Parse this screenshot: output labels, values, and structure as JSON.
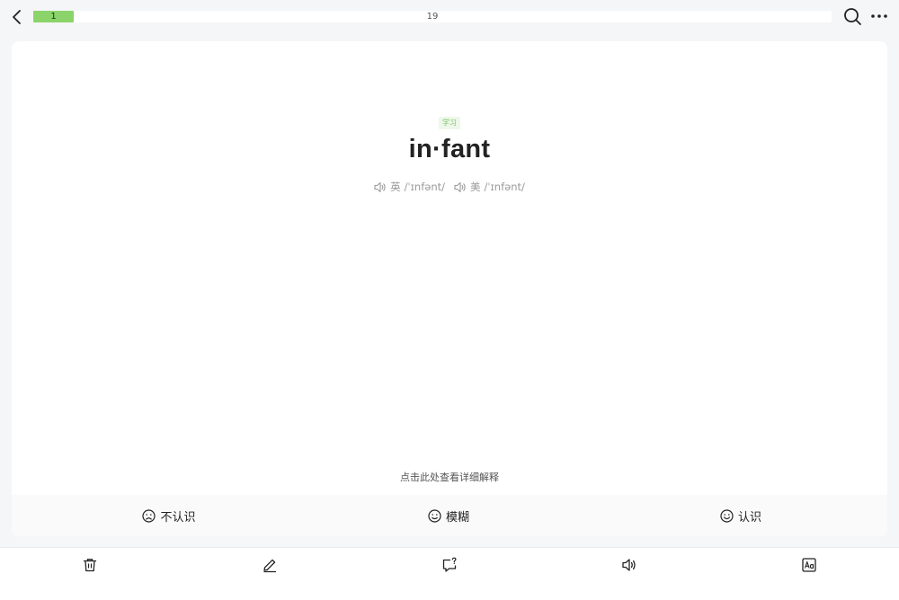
{
  "progress": {
    "current": "1",
    "total": "19",
    "fraction": 0.0526,
    "fill_color": "#8bd46a"
  },
  "header_icons": {
    "back": "chevron-left-icon",
    "search": "search-icon",
    "more": "more-horizontal-icon"
  },
  "word_card": {
    "tag": "学习",
    "word": "in·fant",
    "phonetics": [
      {
        "region": "英",
        "ipa": "/ˈɪnfənt/",
        "icon": "speaker-icon"
      },
      {
        "region": "美",
        "ipa": "/ˈɪnfənt/",
        "icon": "speaker-icon"
      }
    ],
    "hint": "点击此处查看详细解释"
  },
  "ratings": [
    {
      "label": "不认识",
      "icon": "sad-face-icon"
    },
    {
      "label": "模糊",
      "icon": "neutral-face-icon"
    },
    {
      "label": "认识",
      "icon": "smile-face-icon"
    }
  ],
  "toolbar": [
    {
      "name": "delete",
      "icon": "trash-icon"
    },
    {
      "name": "edit",
      "icon": "pencil-icon"
    },
    {
      "name": "feedback",
      "icon": "question-chat-icon"
    },
    {
      "name": "pronounce",
      "icon": "speaker-icon"
    },
    {
      "name": "font",
      "icon": "font-size-icon"
    }
  ],
  "colors": {
    "accent": "#8bd46a",
    "tag_bg": "#eef8ea",
    "tag_text": "#7cc36a"
  }
}
